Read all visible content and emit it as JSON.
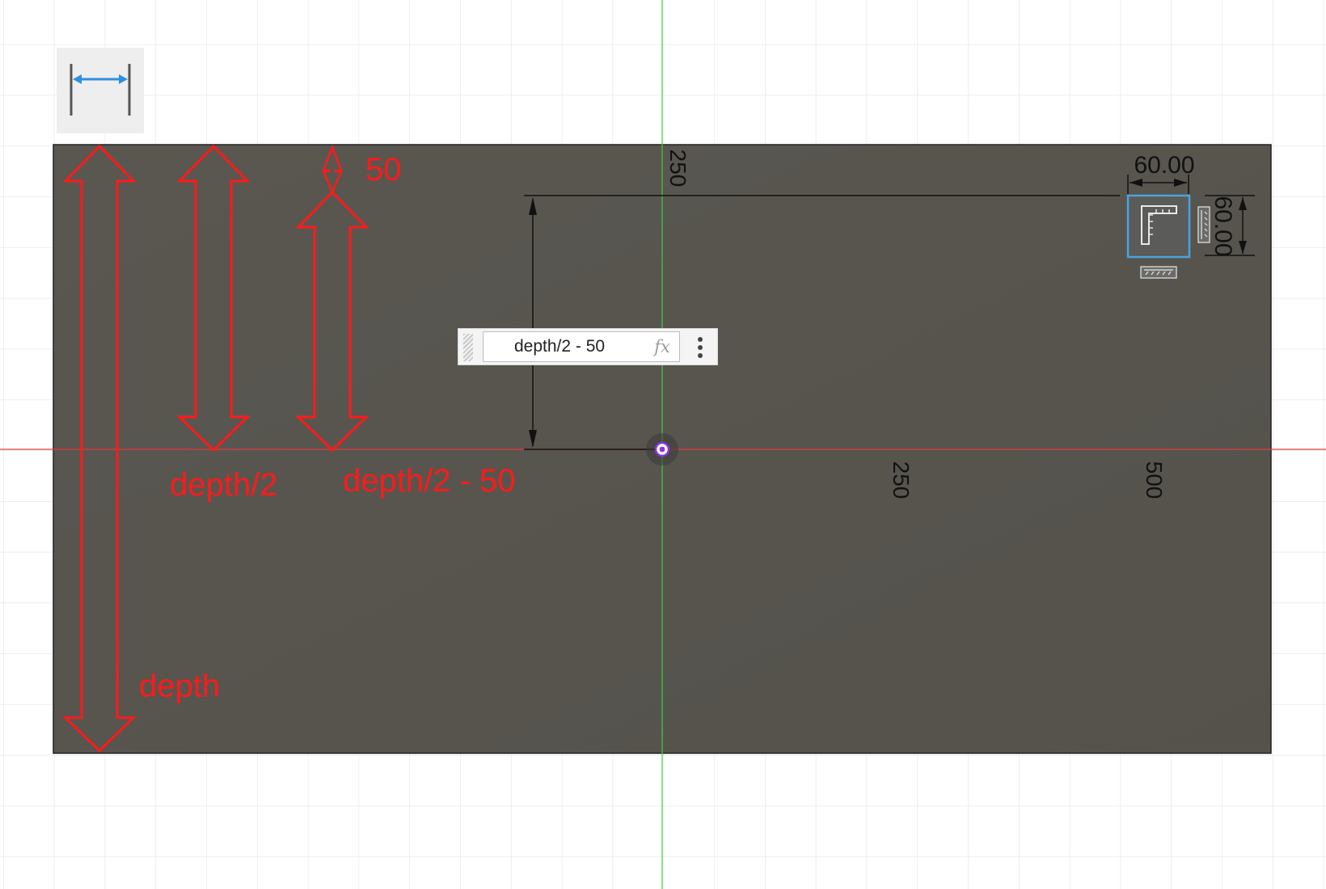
{
  "toolbar": {
    "dimension_tool_icon": "horizontal-dimension-icon"
  },
  "canvas": {
    "axis_labels": {
      "y_top": "250",
      "x_250": "250",
      "x_500": "500"
    },
    "annotations": {
      "fifty": "50",
      "depth_half": "depth/2",
      "depth_half_minus_50": "depth/2 - 50",
      "depth": "depth"
    },
    "small_square": {
      "width_label": "60.00",
      "height_label": "60.00"
    }
  },
  "dimension_input": {
    "value": "depth/2 - 50",
    "fx_label": "fx",
    "menu_icon": "more-vertical-icon"
  },
  "colors": {
    "plate_fill": "#58554f",
    "annotation_red": "#ff1a1a",
    "x_axis": "#e23a3a",
    "y_axis": "#3ccf3c",
    "grid": "#e2e2e2",
    "selection_blue": "#4aa3df",
    "origin_purple": "#8a35d8"
  }
}
